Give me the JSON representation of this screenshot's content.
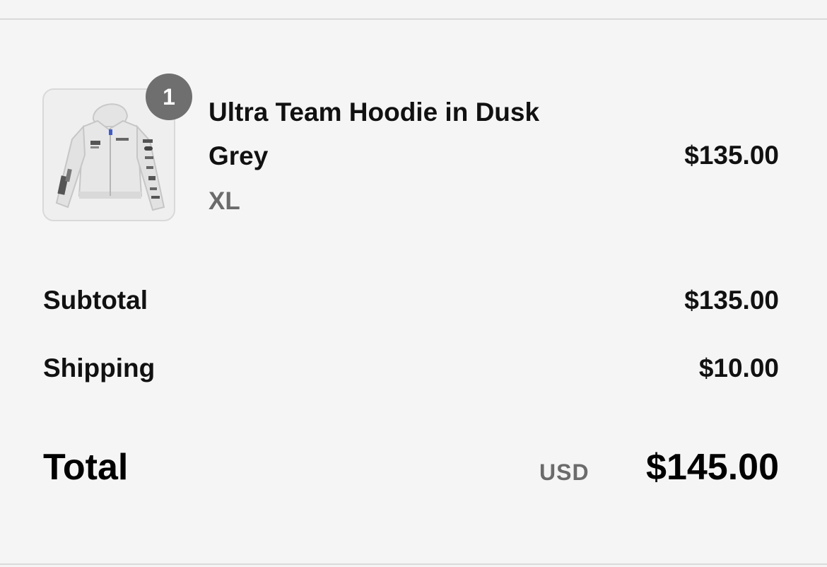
{
  "order_summary": {
    "line_items": [
      {
        "quantity": "1",
        "title": "Ultra Team Hoodie in Dusk Grey",
        "variant": "XL",
        "price": "$135.00",
        "image_icon": "hoodie-product-image"
      }
    ],
    "subtotal": {
      "label": "Subtotal",
      "value": "$135.00"
    },
    "shipping": {
      "label": "Shipping",
      "value": "$10.00"
    },
    "total": {
      "label": "Total",
      "currency": "USD",
      "value": "$145.00"
    }
  },
  "colors": {
    "background": "#f5f5f5",
    "badge": "#6f6f6f",
    "muted_text": "#6b6b6b",
    "divider": "#dadada"
  }
}
